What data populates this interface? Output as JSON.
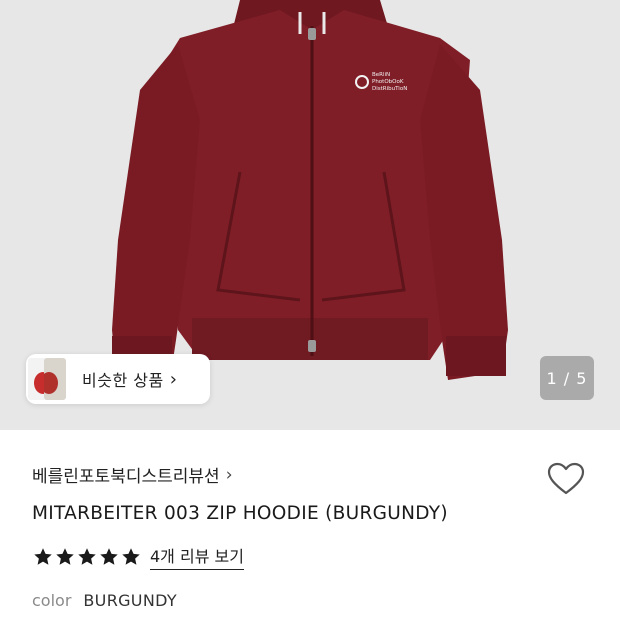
{
  "hero": {
    "image_icon": "burgundy-zip-hoodie-photo",
    "logo_text_lines": [
      "BeRliN",
      "PhotObOoK",
      "DistRibuTioN"
    ],
    "similar_label": "비슷한 상품",
    "similar_chevron": "›",
    "pager": "1 / 5"
  },
  "product": {
    "brand": "베를린포토북디스트리뷰션",
    "brand_chevron": "›",
    "title": "MITARBEITER 003 ZIP HOODIE (BURGUNDY)",
    "stars": 5,
    "reviews_link": "4개 리뷰 보기",
    "color_label": "color",
    "color_value": "BURGUNDY",
    "wishlist_icon": "heart-icon"
  },
  "colors": {
    "hoodie": "#7f1d26",
    "hero_bg": "#e7e7e7",
    "star": "#1a1a1a"
  }
}
